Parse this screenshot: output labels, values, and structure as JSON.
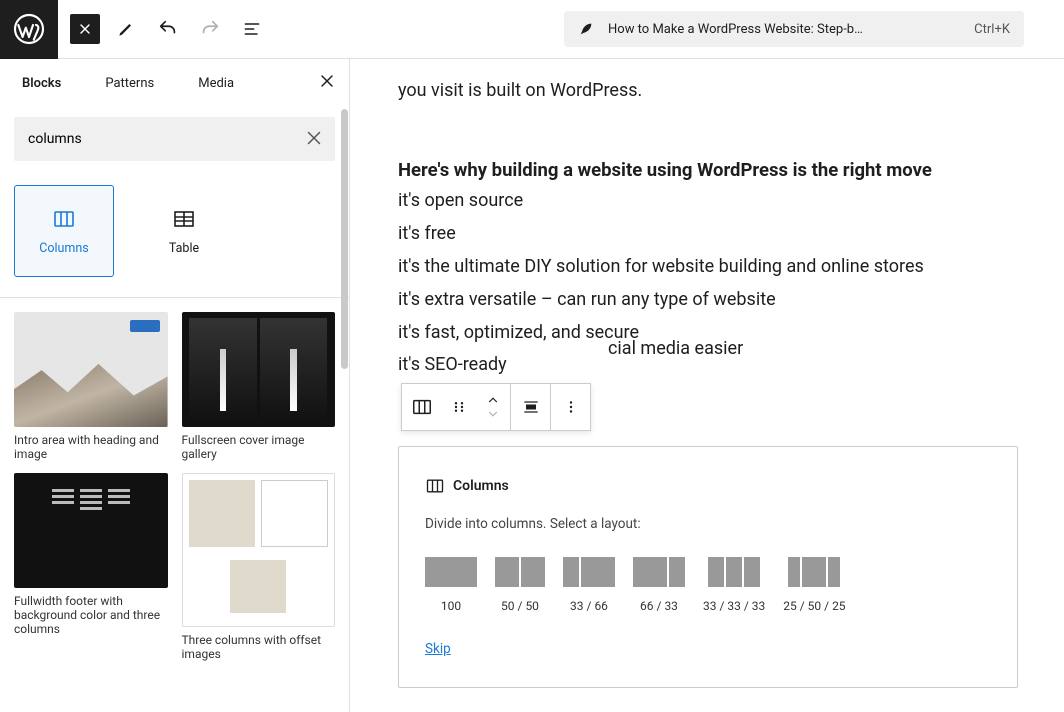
{
  "topbar": {
    "doc_title": "How to Make a WordPress Website: Step-b…",
    "shortcut": "Ctrl+K"
  },
  "sidebar": {
    "tabs": {
      "blocks": "Blocks",
      "patterns": "Patterns",
      "media": "Media"
    },
    "search_value": "columns",
    "blocks": {
      "columns": "Columns",
      "table": "Table"
    },
    "patterns": [
      "Intro area with heading and image",
      "Fullscreen cover image gallery",
      "Fullwidth footer with background color and three columns",
      "Three columns with offset images"
    ]
  },
  "content": {
    "lead": "you visit is built on WordPress.",
    "heading": "Here's why building a website using WordPress is the right move",
    "bullets": [
      "it's open source",
      "it's free",
      "it's the ultimate DIY solution for website building and online stores",
      "it's extra versatile – can run any type of website",
      "it's fast, optimized, and secure",
      "it's SEO-ready"
    ],
    "trail": "cial media easier"
  },
  "placeholder": {
    "title": "Columns",
    "desc": "Divide into columns. Select a layout:",
    "layouts": [
      {
        "label": "100",
        "widths": [
          52
        ]
      },
      {
        "label": "50 / 50",
        "widths": [
          24,
          24
        ]
      },
      {
        "label": "33 / 66",
        "widths": [
          16,
          34
        ]
      },
      {
        "label": "66 / 33",
        "widths": [
          34,
          16
        ]
      },
      {
        "label": "33 / 33 / 33",
        "widths": [
          16,
          16,
          16
        ]
      },
      {
        "label": "25 / 50 / 25",
        "widths": [
          12,
          24,
          12
        ]
      }
    ],
    "skip": "Skip"
  }
}
